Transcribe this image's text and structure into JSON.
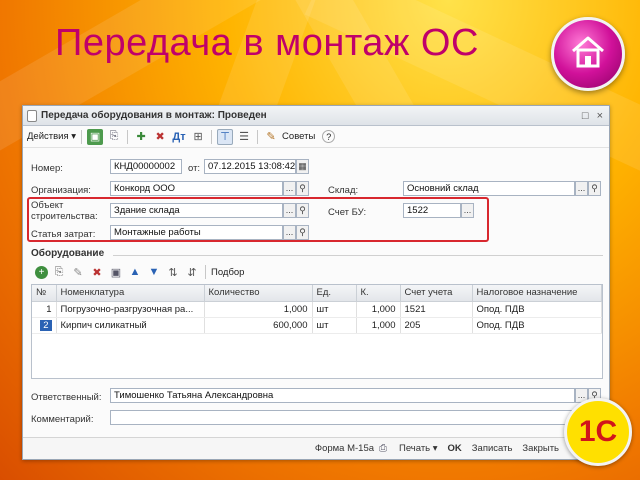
{
  "slide": {
    "title": "Передача в монтаж ОС"
  },
  "logo": {
    "text": "1С"
  },
  "window": {
    "title": "Передача оборудования в монтаж: Проведен",
    "controls": [
      "□",
      "×"
    ]
  },
  "toolbar": {
    "actions_label": "Действия",
    "tips_label": "Советы",
    "help_label": "?"
  },
  "form": {
    "number_label": "Номер:",
    "number_value": "КНД00000002",
    "from_label": "от:",
    "date_value": "07.12.2015 13:08:42",
    "org_label": "Организация:",
    "org_value": "Конкорд ООО",
    "warehouse_label": "Склад:",
    "warehouse_value": "Основний склад",
    "object_label_1": "Объект",
    "object_label_2": "строительства:",
    "object_value": "Здание склада",
    "account_label": "Счет БУ:",
    "account_value": "1522",
    "cost_label": "Статья затрат:",
    "cost_value": "Монтажные работы"
  },
  "equipment": {
    "section_title": "Оборудование",
    "selection_label": "Подбор",
    "columns": [
      "№",
      "Номенклатура",
      "Количество",
      "Ед.",
      "К.",
      "Счет учета",
      "Налоговое назначение"
    ],
    "rows": [
      {
        "n": "1",
        "name": "Погрузочно-разгрузочная ра...",
        "qty": "1,000",
        "unit": "шт",
        "k": "1,000",
        "account": "1521",
        "tax": "Опод. ПДВ"
      },
      {
        "n": "2",
        "name": "Кирпич силикатный",
        "qty": "600,000",
        "unit": "шт",
        "k": "1,000",
        "account": "205",
        "tax": "Опод. ПДВ"
      }
    ]
  },
  "footer_fields": {
    "responsible_label": "Ответственный:",
    "responsible_value": "Тимошенко Татьяна Александровна",
    "comment_label": "Комментарий:",
    "comment_value": ""
  },
  "bottombar": {
    "form_label": "Форма М-15а",
    "print_label": "Печать ▾",
    "ok_label": "OK",
    "save_label": "Записать",
    "close_label": "Закрыть"
  }
}
